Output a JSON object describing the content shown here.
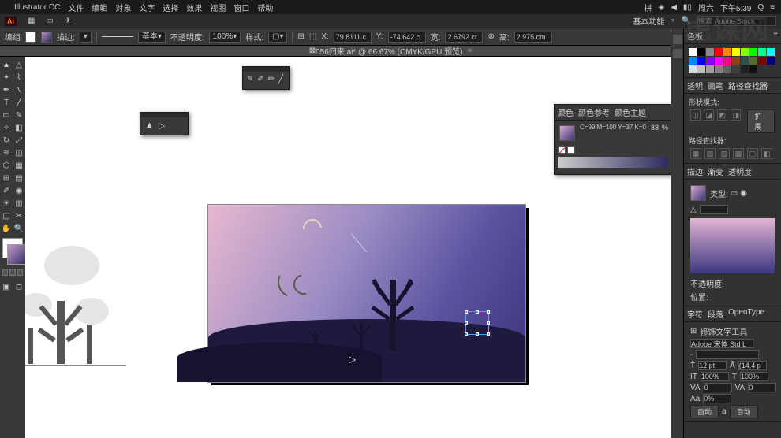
{
  "menubar": {
    "app": "Illustrator CC",
    "items": [
      "文件",
      "编辑",
      "对象",
      "文字",
      "选择",
      "效果",
      "视图",
      "窗口",
      "帮助"
    ],
    "right": {
      "wifi": "⌐",
      "battery": "▮",
      "day": "周六",
      "time": "下午5:39"
    }
  },
  "appbar": {
    "ai": "Ai",
    "workspace": "基本功能",
    "search_ph": "搜索 Adobe Stock"
  },
  "optbar": {
    "label_group": "编组",
    "stroke_label": "描边:",
    "stroke_val": "",
    "style_label": "基本",
    "opacity_label": "不透明度:",
    "opacity_val": "100%",
    "stylelist_label": "样式:",
    "x_label": "X:",
    "x_val": "79.8111 c",
    "y_label": "Y:",
    "y_val": "-74.642 c",
    "w_label": "宽:",
    "w_val": "2.6792 cr",
    "h_label": "高:",
    "h_val": "2.975 cm"
  },
  "docbar": {
    "name": "056归来.ai* @ 66.67% (CMYK/GPU 预览)"
  },
  "colorpanel": {
    "tabs": [
      "颜色",
      "颜色参考",
      "颜色主题"
    ],
    "readout": "C=99 M=100 Y=37 K=0",
    "val": "88"
  },
  "rpanel": {
    "swatch_tabs": [
      "色板"
    ],
    "path_tabs": [
      "透明",
      "画笔",
      "路径查找器"
    ],
    "shape_label": "形状模式:",
    "expand": "扩展",
    "pathfind_label": "路径查找器:",
    "grad_tabs": [
      "描边",
      "渐变",
      "透明度"
    ],
    "type_label": "类型:",
    "opac_label": "不透明度:",
    "pos_label": "位置:",
    "char_tabs": [
      "字符",
      "段落",
      "OpenType"
    ],
    "touch_label": "修饰文字工具",
    "font": "Adobe 宋体 Std L",
    "size_label": "",
    "size_val": "12 pt",
    "lead_val": "(14.4 p",
    "track_val": "100%",
    "track2": "100%",
    "va": "0",
    "kern": "0",
    "baseline": "0%",
    "auto1": "自动",
    "auto2": "自动"
  },
  "swatches_colors": [
    "#fff",
    "#000",
    "#888",
    "#f00",
    "#f80",
    "#ff0",
    "#8f0",
    "#0f0",
    "#0f8",
    "#0ff",
    "#08f",
    "#00f",
    "#80f",
    "#f0f",
    "#f08",
    "#8b4513",
    "#2f4f4f",
    "#556b2f",
    "#800000",
    "#000080",
    "#e0e0e0",
    "#c0c0c0",
    "#a0a0a0",
    "#808080",
    "#606060",
    "#404040",
    "#202020",
    "#101010"
  ]
}
